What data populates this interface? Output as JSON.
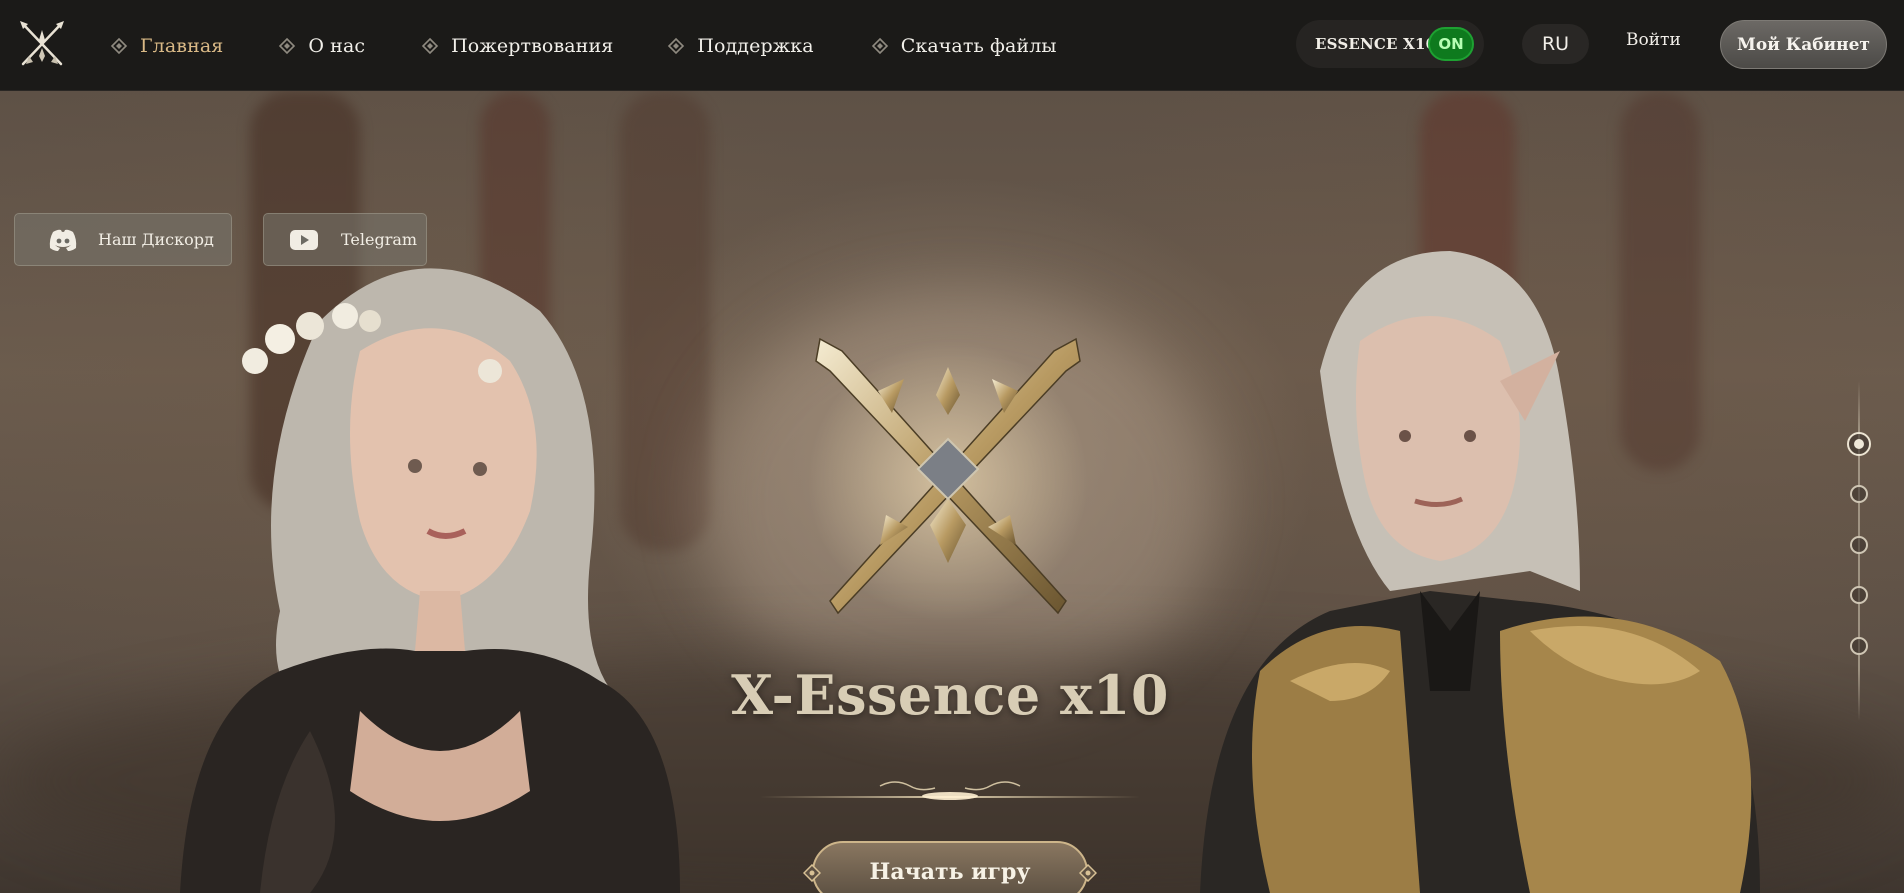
{
  "header": {
    "nav": [
      {
        "label": "Главная",
        "active": true
      },
      {
        "label": "О нас",
        "active": false
      },
      {
        "label": "Пожертвования",
        "active": false
      },
      {
        "label": "Поддержка",
        "active": false
      },
      {
        "label": "Скачать файлы",
        "active": false
      }
    ],
    "server": {
      "name": "ESSENCE X10",
      "status": "ON"
    },
    "language": "RU",
    "login_label": "Войти",
    "cabinet_label": "Мой Кабинет"
  },
  "social": {
    "discord_label": "Наш Дискорд",
    "telegram_label": "Telegram"
  },
  "hero": {
    "title": "X-Essence x10",
    "start_label": "Начать игру"
  },
  "slider": {
    "count": 5,
    "active_index": 0
  },
  "colors": {
    "header_bg": "#1b1a18",
    "accent_gold": "#d9b986",
    "status_green": "#0e7a1e",
    "title_color": "#d8cdb5"
  },
  "icons": {
    "logo": "crossed-swords-logo-icon",
    "nav_bullet": "diamond-icon",
    "discord": "discord-icon",
    "telegram": "youtube-play-icon"
  }
}
